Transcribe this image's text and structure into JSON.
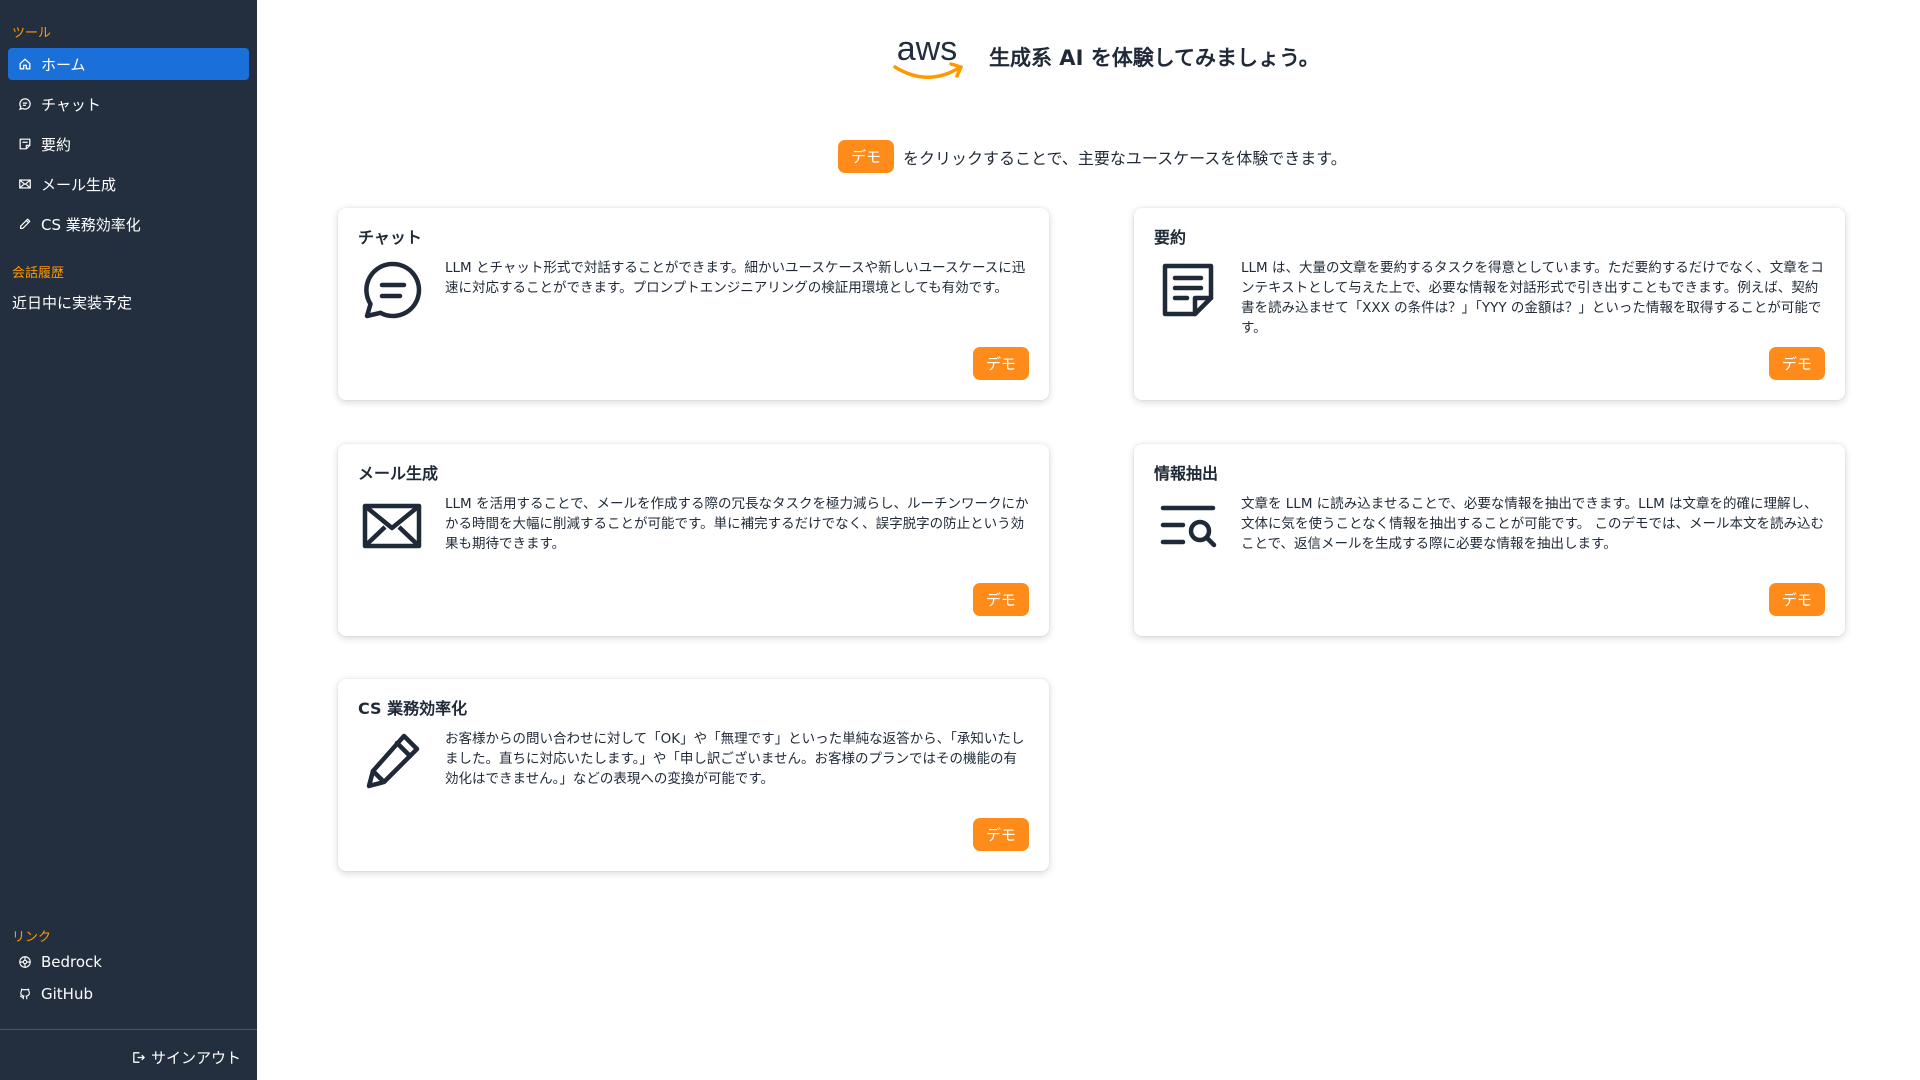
{
  "sidebar": {
    "tools_label": "ツール",
    "items": [
      {
        "label": "ホーム",
        "icon": "home-icon",
        "active": true
      },
      {
        "label": "チャット",
        "icon": "chat-icon"
      },
      {
        "label": "要約",
        "icon": "note-icon"
      },
      {
        "label": "メール生成",
        "icon": "mail-icon"
      },
      {
        "label": "CS 業務効率化",
        "icon": "pencil-icon"
      }
    ],
    "history_label": "会話履歴",
    "history_empty": "近日中に実装予定",
    "links_label": "リンク",
    "links": [
      {
        "label": "Bedrock",
        "icon": "bedrock-icon"
      },
      {
        "label": "GitHub",
        "icon": "github-icon"
      }
    ],
    "signout_label": "サインアウト"
  },
  "hero": {
    "logo_text": "aws",
    "title": "生成系 AI を体験してみましょう。"
  },
  "intro": {
    "demo_label": "デモ",
    "text": "をクリックすることで、主要なユースケースを体験できます。"
  },
  "cards": [
    {
      "title": "チャット",
      "icon": "chat-bubble-icon",
      "description": "LLM とチャット形式で対話することができます。細かいユースケースや新しいユースケースに迅速に対応することができます。プロンプトエンジニアリングの検証用環境としても有効です。",
      "button": "デモ"
    },
    {
      "title": "要約",
      "icon": "document-icon",
      "description": "LLM は、大量の文章を要約するタスクを得意としています。ただ要約するだけでなく、文章をコンテキストとして与えた上で、必要な情報を対話形式で引き出すこともできます。例えば、契約書を読み込ませて「XXX の条件は？」「YYY の金額は？」といった情報を取得することが可能です。",
      "button": "デモ"
    },
    {
      "title": "メール生成",
      "icon": "envelope-icon",
      "description": "LLM を活用することで、メールを作成する際の冗長なタスクを極力減らし、ルーチンワークにかかる時間を大幅に削減することが可能です。単に補完するだけでなく、誤字脱字の防止という効果も期待できます。",
      "button": "デモ"
    },
    {
      "title": "情報抽出",
      "icon": "list-search-icon",
      "description": "文章を LLM に読み込ませることで、必要な情報を抽出できます。LLM は文章を的確に理解し、文体に気を使うことなく情報を抽出することが可能です。 このデモでは、メール本文を読み込むことで、返信メールを生成する際に必要な情報を抽出します。",
      "button": "デモ"
    },
    {
      "title": "CS 業務効率化",
      "icon": "pencil-large-icon",
      "description": "お客様からの問い合わせに対して「OK」や「無理です」といった単純な返答から、「承知いたしました。直ちに対応いたします。」や「申し訳ございません。お客様のプランではその機能の有効化はできません。」などの表現への変換が可能です。",
      "button": "デモ"
    }
  ],
  "colors": {
    "sidebar_bg": "#232f3e",
    "accent_orange": "#ff8c1a",
    "active_blue": "#1a6fd8",
    "section_label": "#ff9900"
  }
}
